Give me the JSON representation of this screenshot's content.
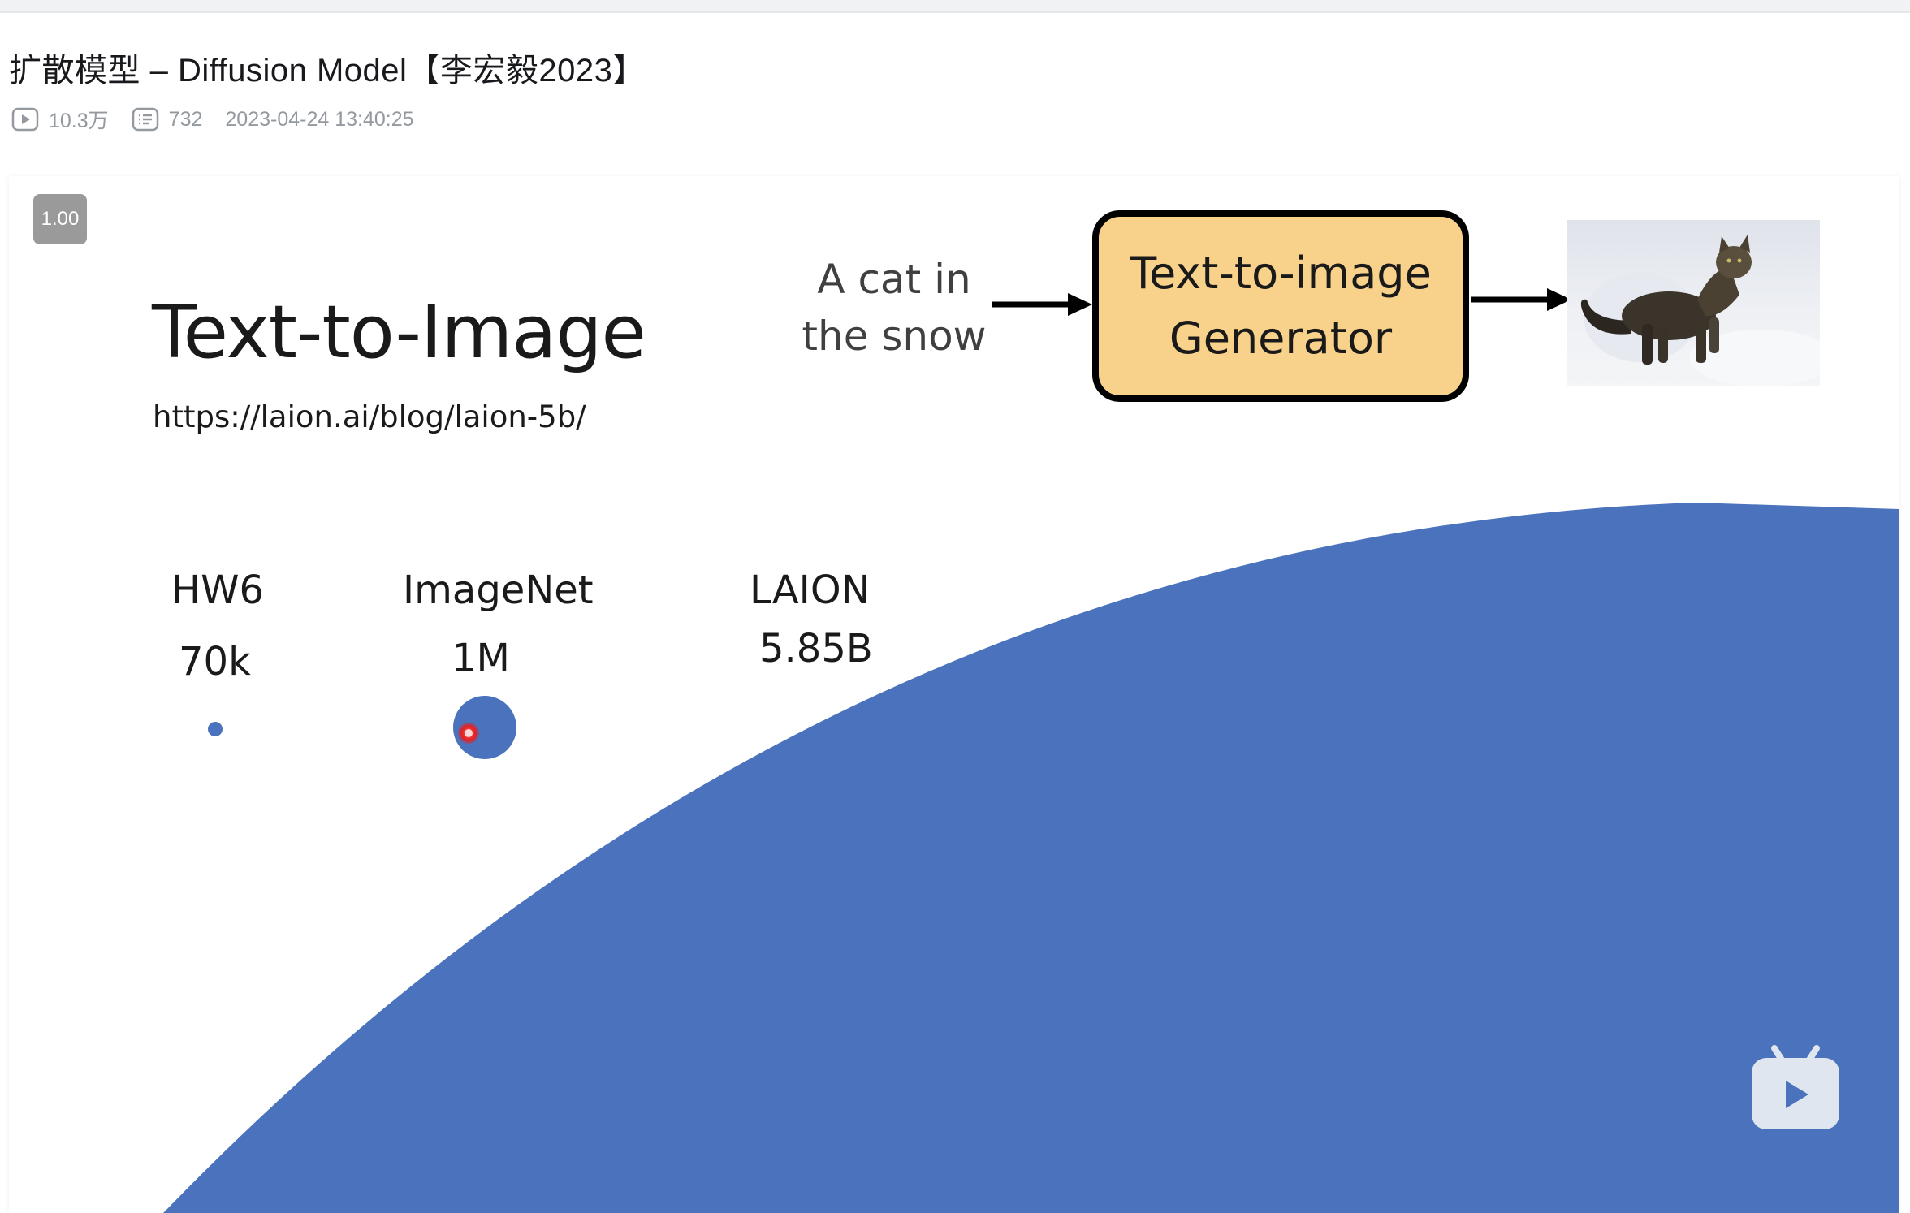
{
  "video": {
    "title": "扩散模型 – Diffusion Model【李宏毅2023】",
    "views": "10.3万",
    "danmaku": "732",
    "publish_time": "2023-04-24 13:40:25"
  },
  "player": {
    "speed_badge": "1.00",
    "logo_icon": "bilibili-tv-play-icon"
  },
  "slide": {
    "title": "Text-to-Image",
    "url": "https://laion.ai/blog/laion-5b/",
    "prompt_line1": "A cat in",
    "prompt_line2": "the snow",
    "generator_line1": "Text-to-image",
    "generator_line2": "Generator",
    "datasets": [
      {
        "name": "HW6",
        "size": "70k"
      },
      {
        "name": "ImageNet",
        "size": "1M"
      },
      {
        "name": "LAION",
        "size": "5.85B"
      }
    ],
    "accent_color": "#4a72bd",
    "generator_color": "#f8d18a"
  },
  "icons": {
    "views": "play-count-icon",
    "danmaku": "danmaku-count-icon",
    "arrow": "right-arrow-icon"
  }
}
